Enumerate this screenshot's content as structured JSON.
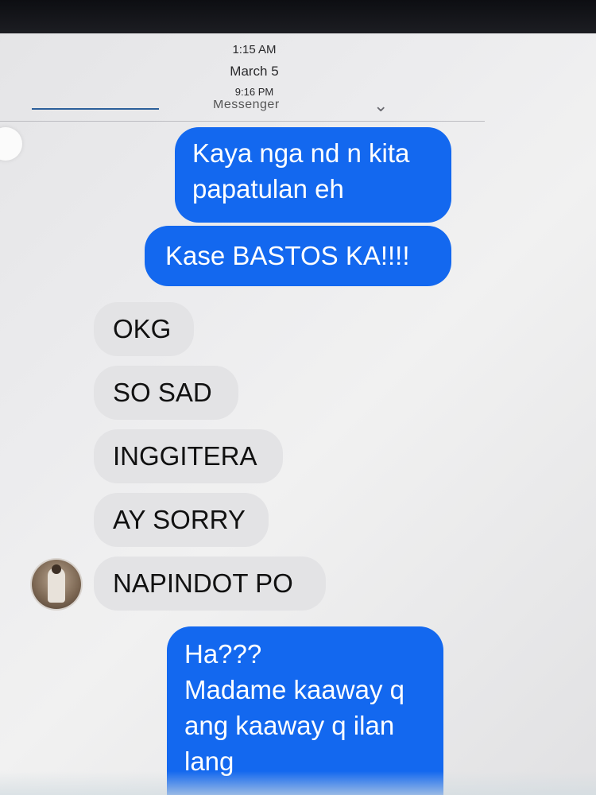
{
  "header": {
    "time_top": "1:15 AM",
    "date": "March 5",
    "time_sub": "9:16 PM",
    "app_label": "Messenger"
  },
  "messages": [
    {
      "side": "sent",
      "text": "Kaya nga nd n kita\npapatulan eh"
    },
    {
      "side": "sent",
      "text": "Kase BASTOS KA!!!!"
    },
    {
      "side": "received",
      "text": "OKG"
    },
    {
      "side": "received",
      "text": "SO SAD"
    },
    {
      "side": "received",
      "text": "INGGITERA"
    },
    {
      "side": "received",
      "text": "AY SORRY"
    },
    {
      "side": "received",
      "text": "NAPINDOT PO"
    },
    {
      "side": "sent",
      "text": "Ha???\nMadame kaaway q\nang kaaway q ilan\nlang"
    }
  ],
  "colors": {
    "sent_bubble": "#1368ef",
    "received_bubble": "#e3e3e5",
    "background": "#ececee"
  },
  "icons": {
    "avatar": "contact-avatar",
    "chevron": "chevron-down-icon"
  }
}
